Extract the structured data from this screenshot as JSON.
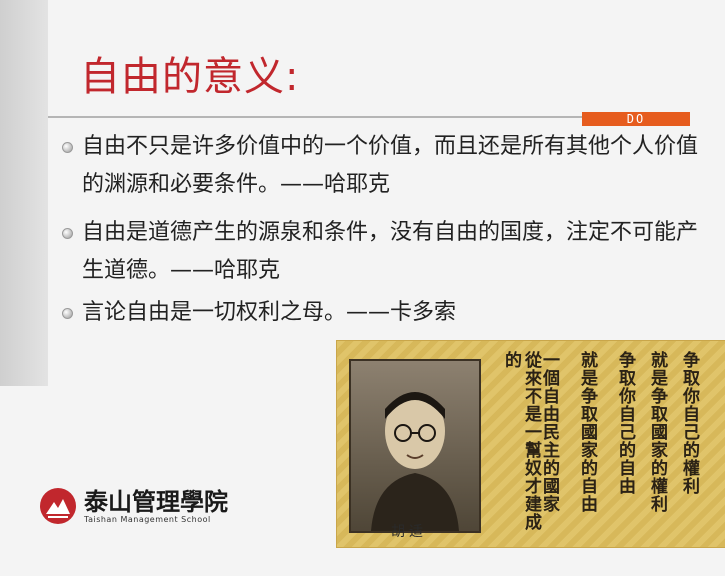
{
  "slide": {
    "title": "自由的意义:",
    "badge": "DO",
    "bullets": [
      "自由不只是许多价值中的一个价值，而且还是所有其他个人价值的渊源和必要条件。——哈耶克",
      "自由是道德产生的源泉和条件，没有自由的国度，注定不可能产生道德。——哈耶克",
      "言论自由是一切权利之母。——卡多索"
    ]
  },
  "logo": {
    "name_cn": "泰山管理學院",
    "name_en": "Taishan Management School"
  },
  "panel": {
    "caption": "胡适",
    "columns": [
      "争取你自己的權利",
      "就是争取國家的權利",
      "争取你自己的自由",
      "就是争取國家的自由",
      "一個自由民主的國家",
      "從來不是一幫奴才建成的"
    ]
  }
}
